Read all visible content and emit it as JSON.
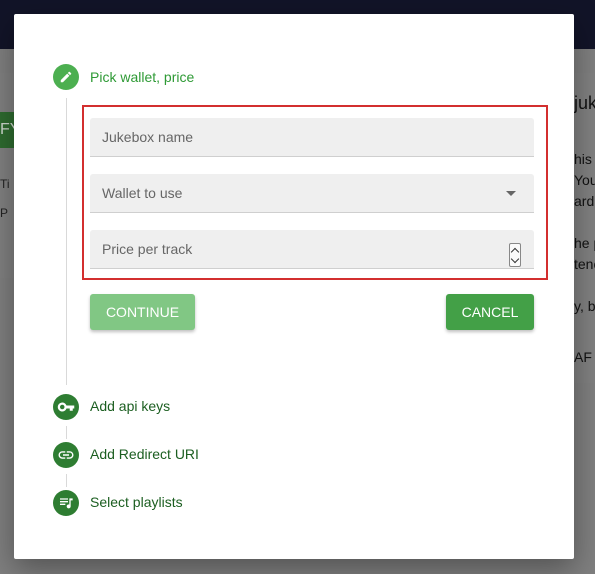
{
  "background": {
    "left_button_fragment": "FY",
    "left_rows": [
      "Ti",
      "P"
    ],
    "right_fragments": [
      "juk",
      "his",
      "You",
      "ard",
      "he p",
      "tenc",
      "y, be",
      "AF"
    ]
  },
  "dialog": {
    "steps": [
      {
        "label": "Pick wallet, price",
        "icon": "pencil-icon",
        "active": true
      },
      {
        "label": "Add api keys",
        "icon": "key-icon",
        "active": false
      },
      {
        "label": "Add Redirect URI",
        "icon": "link-icon",
        "active": false
      },
      {
        "label": "Select playlists",
        "icon": "playlist-icon",
        "active": false
      }
    ],
    "form": {
      "jukebox_name": {
        "placeholder": "Jukebox name",
        "value": ""
      },
      "wallet": {
        "placeholder": "Wallet to use",
        "value": ""
      },
      "price": {
        "placeholder": "Price per track",
        "value": ""
      }
    },
    "buttons": {
      "continue": "CONTINUE",
      "cancel": "CANCEL"
    }
  },
  "colors": {
    "accent_green": "#4caf50",
    "dark_green": "#2e7d32",
    "highlight_red": "#d32f2f"
  }
}
